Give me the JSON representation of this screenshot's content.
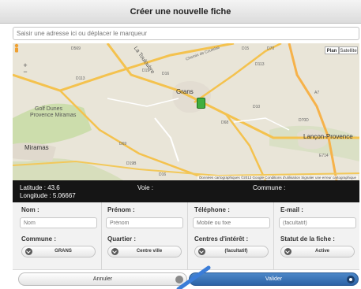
{
  "header": {
    "title": "Créer une nouvelle fiche"
  },
  "search": {
    "placeholder": "Saisir une adresse ici ou déplacer le marqueur"
  },
  "map": {
    "type_buttons": [
      "Plan",
      "Satellite"
    ],
    "zoom": {
      "in": "+",
      "out": "−"
    },
    "places": {
      "grans": "Grans",
      "golf": "Golf Dunes",
      "golf2": "Provence Miramas",
      "miramas": "Miramas",
      "lancon": "Lançon-Provence",
      "touloubre": "La Touloubre",
      "chemin": "Chemin de Coutelas"
    },
    "roads": [
      "D569",
      "D19",
      "D16",
      "D15",
      "D113",
      "D70",
      "D68",
      "D69",
      "D10",
      "D70D",
      "D16",
      "D19B",
      "A7",
      "D113",
      "E714"
    ],
    "credits": "Données cartographiques ©2013 Google   Conditions d'utilisation   Signaler une erreur cartographique"
  },
  "infobar": {
    "latitude": "Latitude : 43.6",
    "longitude": "Longitude : 5.06667",
    "voie": "Voie :",
    "commune": "Commune :"
  },
  "form": {
    "nom": {
      "label": "Nom :",
      "placeholder": "Nom"
    },
    "prenom": {
      "label": "Prénom :",
      "placeholder": "Prénom"
    },
    "telephone": {
      "label": "Téléphone :",
      "placeholder": "Mobile ou fixe"
    },
    "email": {
      "label": "E-mail :",
      "placeholder": "(facultatif)"
    },
    "commune": {
      "label": "Commune :",
      "value": "GRANS"
    },
    "quartier": {
      "label": "Quartier :",
      "value": "Centre ville"
    },
    "centres": {
      "label": "Centres d'intérêt :",
      "value": "(facultatif)"
    },
    "statut": {
      "label": "Statut de la fiche :",
      "value": "Active"
    }
  },
  "buttons": {
    "cancel": "Annuler",
    "validate": "Valider"
  },
  "colors": {
    "primary": "#2d63a6",
    "marker": "#3fae3f",
    "infobar": "#151515"
  }
}
